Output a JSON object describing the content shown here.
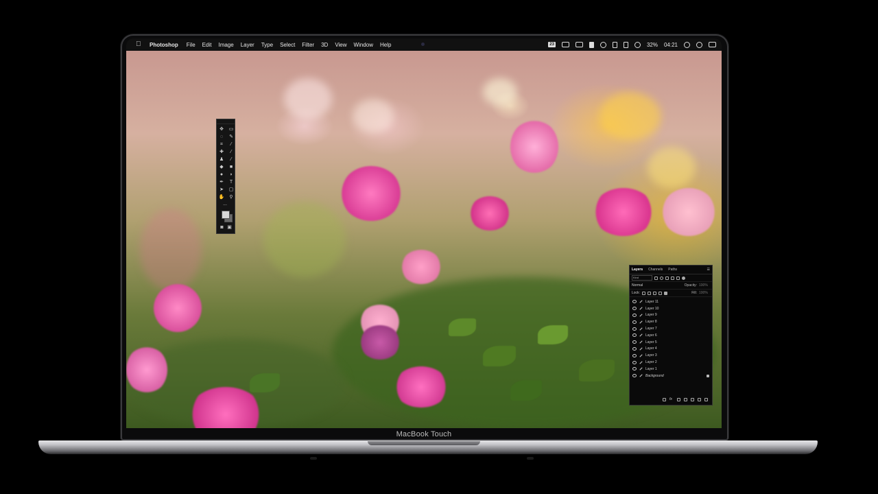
{
  "menubar": {
    "app_name": "Photoshop",
    "items": [
      "File",
      "Edit",
      "Image",
      "Layer",
      "Type",
      "Select",
      "Filter",
      "3D",
      "View",
      "Window",
      "Help"
    ],
    "status": {
      "badge": "23",
      "battery": "32%",
      "time": "04:21"
    }
  },
  "tools_panel": {
    "icons": [
      "move-tool-icon",
      "marquee-tool-icon",
      "lasso-tool-icon",
      "quick-select-tool-icon",
      "crop-tool-icon",
      "eyedropper-tool-icon",
      "healing-brush-icon",
      "brush-tool-icon",
      "clone-stamp-icon",
      "history-brush-icon",
      "eraser-tool-icon",
      "gradient-tool-icon",
      "blur-tool-icon",
      "dodge-tool-icon",
      "pen-tool-icon",
      "type-tool-icon",
      "path-select-icon",
      "shape-tool-icon",
      "hand-tool-icon",
      "zoom-tool-icon"
    ],
    "more": "..."
  },
  "layers_panel": {
    "tabs": [
      "Layers",
      "Channels",
      "Paths"
    ],
    "filter_kind": "Kind",
    "blend_mode": "Normal",
    "opacity_label": "Opacity:",
    "opacity_value": "100%",
    "lock_label": "Lock:",
    "fill_label": "Fill:",
    "fill_value": "100%",
    "layers": [
      "Layer 11",
      "Layer 10",
      "Layer 9",
      "Layer 8",
      "Layer 7",
      "Layer 6",
      "Layer 5",
      "Layer 4",
      "Layer 3",
      "Layer 2",
      "Layer 1"
    ],
    "background_layer": "Background"
  },
  "device": {
    "model_label": "MacBook Touch"
  }
}
